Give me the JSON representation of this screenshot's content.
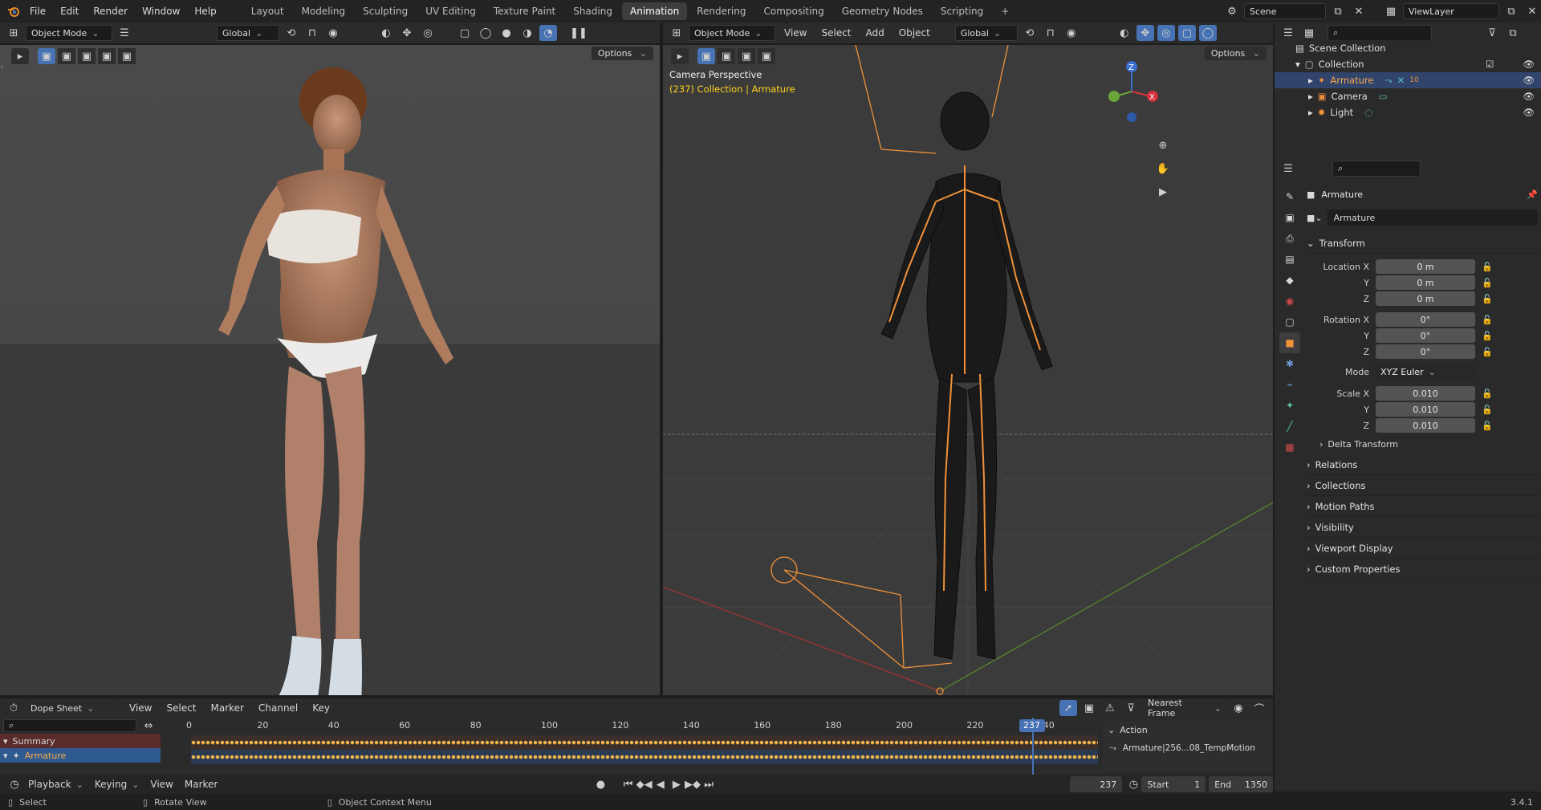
{
  "menubar": {
    "menus": [
      "File",
      "Edit",
      "Render",
      "Window",
      "Help"
    ],
    "workspaces": [
      "Layout",
      "Modeling",
      "Sculpting",
      "UV Editing",
      "Texture Paint",
      "Shading",
      "Animation",
      "Rendering",
      "Compositing",
      "Geometry Nodes",
      "Scripting"
    ],
    "active_workspace": "Animation",
    "scene": "Scene",
    "view_layer": "ViewLayer"
  },
  "left_viewport": {
    "mode": "Object Mode",
    "orientation": "Global",
    "options": "Options"
  },
  "right_viewport": {
    "mode": "Object Mode",
    "menus": [
      "View",
      "Select",
      "Add",
      "Object"
    ],
    "orientation": "Global",
    "options": "Options",
    "camera_label": "Camera Perspective",
    "collection_label": "(237) Collection | Armature"
  },
  "outliner": {
    "root": "Scene Collection",
    "collection": "Collection",
    "items": [
      "Armature",
      "Camera",
      "Light"
    ],
    "armature_count": "10"
  },
  "properties": {
    "object_name": "Armature",
    "data_name": "Armature",
    "transform_title": "Transform",
    "location_label": "Location X",
    "rotation_label": "Rotation X",
    "scale_label": "Scale X",
    "axis_y": "Y",
    "axis_z": "Z",
    "location": [
      "0 m",
      "0 m",
      "0 m"
    ],
    "rotation": [
      "0°",
      "0°",
      "0°"
    ],
    "mode_label": "Mode",
    "mode_value": "XYZ Euler",
    "scale": [
      "0.010",
      "0.010",
      "0.010"
    ],
    "delta": "Delta Transform",
    "panels": [
      "Relations",
      "Collections",
      "Motion Paths",
      "Visibility",
      "Viewport Display",
      "Custom Properties"
    ]
  },
  "dopesheet": {
    "editor": "Dope Sheet",
    "menus": [
      "View",
      "Select",
      "Marker",
      "Channel",
      "Key"
    ],
    "snap": "Nearest Frame",
    "ticks": [
      "0",
      "20",
      "40",
      "60",
      "80",
      "100",
      "120",
      "140",
      "160",
      "180",
      "200",
      "220",
      "240"
    ],
    "current_frame": "237",
    "channels": [
      "Summary",
      "Armature"
    ],
    "action_title": "Action",
    "action_name": "Armature|256...08_TempMotion"
  },
  "playback": {
    "menus": [
      "Playback",
      "Keying",
      "View",
      "Marker"
    ],
    "frame": "237",
    "start_label": "Start",
    "start": "1",
    "end_label": "End",
    "end": "1350"
  },
  "statusbar": {
    "select": "Select",
    "rotate": "Rotate View",
    "context": "Object Context Menu",
    "version": "3.4.1"
  },
  "colors": {
    "accent_blue": "#4772b3",
    "selection_orange": "#f0913a",
    "text_yellow": "#ffd21f"
  }
}
